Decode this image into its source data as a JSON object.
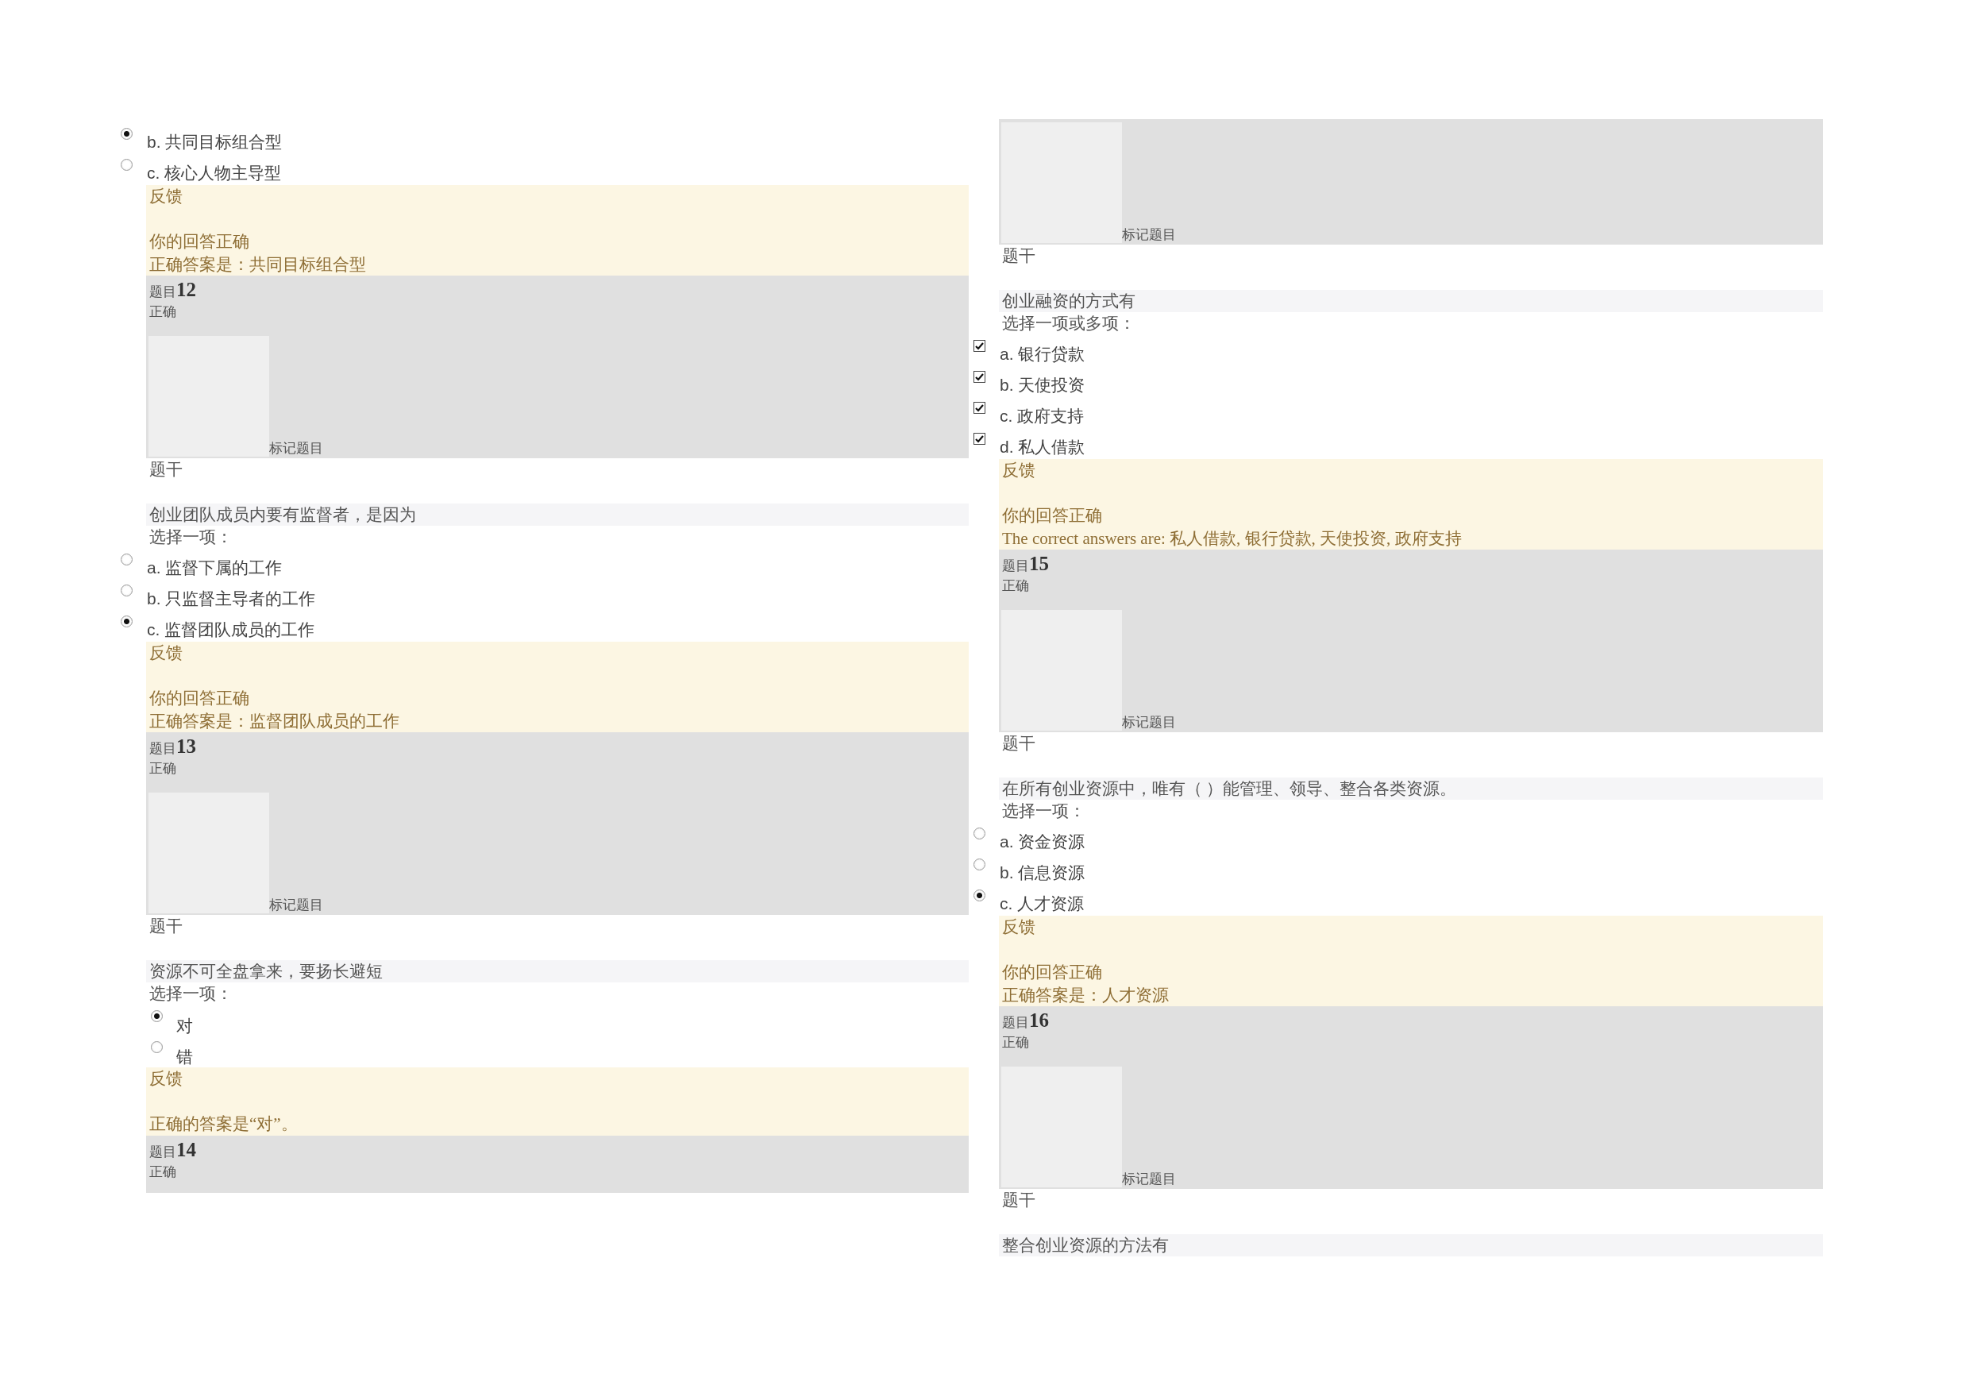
{
  "columns": [
    {
      "blocks": [
        {
          "kind": "radios",
          "items": [
            {
              "label": "b. 共同目标组合型",
              "selected": true
            },
            {
              "label": "c. 核心人物主导型",
              "selected": false
            }
          ]
        },
        {
          "kind": "feedback",
          "title": "反馈",
          "lines": [
            "你的回答正确",
            "正确答案是：共同目标组合型"
          ]
        },
        {
          "kind": "header",
          "prefix": "题目",
          "number": "12",
          "status": "正确",
          "flag": "标记题目"
        },
        {
          "kind": "question",
          "label": "题干",
          "stem": "创业团队成员内要有监督者，是因为",
          "instruction": "选择一项："
        },
        {
          "kind": "radios",
          "items": [
            {
              "label": "a. 监督下属的工作",
              "selected": false
            },
            {
              "label": "b. 只监督主导者的工作",
              "selected": false
            },
            {
              "label": "c. 监督团队成员的工作",
              "selected": true
            }
          ]
        },
        {
          "kind": "feedback",
          "title": "反馈",
          "lines": [
            "你的回答正确",
            "正确答案是：监督团队成员的工作"
          ]
        },
        {
          "kind": "header",
          "prefix": "题目",
          "number": "13",
          "status": "正确",
          "flag": "标记题目"
        },
        {
          "kind": "question",
          "label": "题干",
          "stem": "资源不可全盘拿来，要扬长避短",
          "instruction": "选择一项："
        },
        {
          "kind": "truefalse",
          "items": [
            {
              "label": "对",
              "selected": true
            },
            {
              "label": "错",
              "selected": false
            }
          ]
        },
        {
          "kind": "feedback",
          "title": "反馈",
          "lines": [
            "正确的答案是“对”。"
          ]
        },
        {
          "kind": "header",
          "prefix": "题目",
          "number": "14",
          "status": "正确"
        }
      ]
    },
    {
      "blocks": [
        {
          "kind": "header",
          "flag": "标记题目"
        },
        {
          "kind": "question",
          "label": "题干",
          "stem": "创业融资的方式有",
          "instruction": "选择一项或多项："
        },
        {
          "kind": "checkboxes",
          "items": [
            {
              "label": "a. 银行贷款",
              "checked": true
            },
            {
              "label": "b. 天使投资",
              "checked": true
            },
            {
              "label": "c. 政府支持",
              "checked": true
            },
            {
              "label": "d. 私人借款",
              "checked": true
            }
          ]
        },
        {
          "kind": "feedback",
          "title": "反馈",
          "lines": [
            "你的回答正确",
            "The correct answers are: 私人借款, 银行贷款, 天使投资, 政府支持"
          ]
        },
        {
          "kind": "header",
          "prefix": "题目",
          "number": "15",
          "status": "正确",
          "flag": "标记题目"
        },
        {
          "kind": "question",
          "label": "题干",
          "stem": "在所有创业资源中，唯有（ ）能管理、领导、整合各类资源。",
          "instruction": "选择一项："
        },
        {
          "kind": "radios",
          "items": [
            {
              "label": "a. 资金资源",
              "selected": false
            },
            {
              "label": "b. 信息资源",
              "selected": false
            },
            {
              "label": "c. 人才资源",
              "selected": true
            }
          ]
        },
        {
          "kind": "feedback",
          "title": "反馈",
          "lines": [
            "你的回答正确",
            "正确答案是：人才资源"
          ]
        },
        {
          "kind": "header",
          "prefix": "题目",
          "number": "16",
          "status": "正确",
          "flag": "标记题目"
        },
        {
          "kind": "question",
          "label": "题干",
          "stem": "整合创业资源的方法有"
        }
      ]
    }
  ]
}
